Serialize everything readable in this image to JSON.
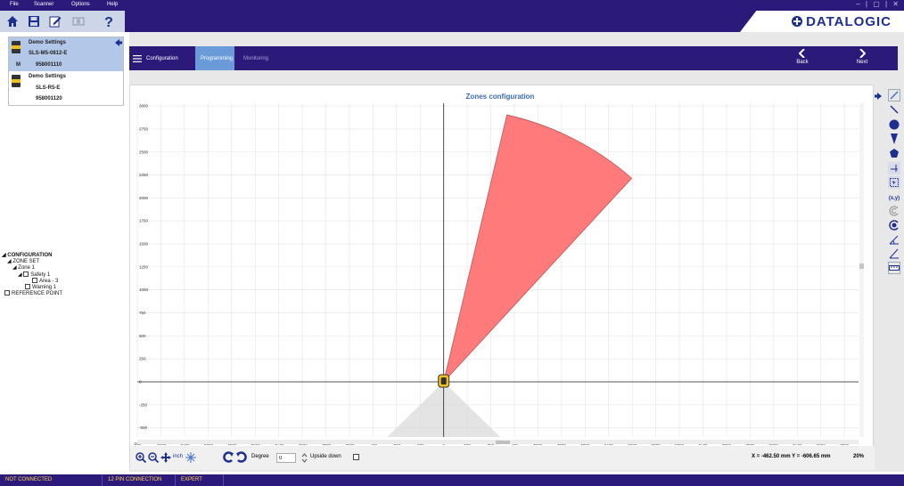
{
  "menu": {
    "items": [
      "File",
      "Scanner",
      "Options",
      "Help"
    ]
  },
  "window_controls": "– | ▢ | ✕",
  "logo_text": "DATALOGIC",
  "devices": [
    {
      "name": "Demo Settings",
      "model": "SLS-M5-0812-E",
      "badge": "M",
      "serial": "958001110",
      "selected": true
    },
    {
      "name": "Demo Settings",
      "model": "SLS-R5-E",
      "serial": "958001120",
      "selected": false
    }
  ],
  "tree": {
    "root": "CONFIGURATION",
    "zoneset": "ZONE SET",
    "zone": "Zone 1",
    "safety": "Safety 1",
    "area": "Area - 3",
    "warning": "Warning 1",
    "reference": "REFERENCE POINT"
  },
  "nav": {
    "tabs": [
      {
        "label": "Configuration",
        "state": "normal"
      },
      {
        "label": "Programming",
        "state": "active"
      },
      {
        "label": "Monitoring",
        "state": "muted"
      }
    ],
    "back_label": "Back",
    "next_label": "Next"
  },
  "chart_data": {
    "type": "polar-zone",
    "title": "Zones configuration",
    "x_ticks": [
      -3250,
      -3000,
      -2750,
      -2500,
      -2250,
      -2000,
      -1750,
      -1500,
      -1250,
      -1000,
      -750,
      -500,
      -250,
      0,
      250,
      500,
      750,
      1000,
      1250,
      1500,
      1750,
      2000,
      2250,
      2500,
      2750,
      3000,
      3250,
      3500,
      3750,
      4000,
      4250
    ],
    "y_ticks": [
      3000,
      2750,
      2500,
      2250,
      2000,
      1750,
      1500,
      1250,
      1000,
      750,
      500,
      250,
      0,
      -250,
      -500
    ],
    "first_x_tick_label": "-250",
    "y_top_tick_label": "3000",
    "xlim": [
      -3250,
      4400
    ],
    "ylim": [
      -600,
      3030
    ],
    "zone": {
      "radius": 2980,
      "start_angle_deg": 48,
      "end_angle_deg": 77,
      "color": "#ff7a7a"
    },
    "dead_zone_angle_deg": 45,
    "grid": true
  },
  "bottom": {
    "unit_label": "inch",
    "degree_label": "Degree",
    "degree_value": "0",
    "upside_down_label": "Upside down",
    "coords": "X = -462.50 mm  Y = -606.65 mm",
    "zoom": "20%"
  },
  "status": [
    "NOT CONNECTED",
    "12 PIN CONNECTION",
    "EXPERT"
  ],
  "colors": {
    "brand": "#2b1a7a",
    "accent": "#6a9ad8",
    "zone": "#ff7a7a",
    "status_text": "#ffd84a"
  }
}
